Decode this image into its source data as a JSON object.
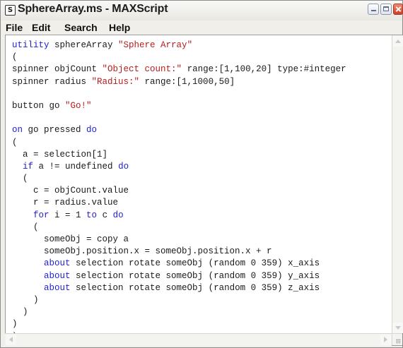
{
  "window": {
    "title": "SphereArray.ms - MAXScript",
    "app_icon_glyph": "S"
  },
  "menu": {
    "file": "File",
    "edit": "Edit",
    "search": "Search",
    "help": "Help"
  },
  "code": {
    "colors": {
      "keyword": "#1f1fd1",
      "string": "#b51c1c",
      "text": "#1a1a1a"
    },
    "lines": [
      [
        {
          "t": "utility",
          "c": "kw"
        },
        {
          "t": " sphereArray "
        },
        {
          "t": "\"Sphere Array\"",
          "c": "str"
        }
      ],
      [
        {
          "t": "("
        }
      ],
      [
        {
          "t": "spinner objCount "
        },
        {
          "t": "\"Object count:\"",
          "c": "str"
        },
        {
          "t": " range:[1,100,20] type:#integer"
        }
      ],
      [
        {
          "t": "spinner radius "
        },
        {
          "t": "\"Radius:\"",
          "c": "str"
        },
        {
          "t": " range:[1,1000,50]"
        }
      ],
      [
        {
          "t": ""
        }
      ],
      [
        {
          "t": "button go "
        },
        {
          "t": "\"Go!\"",
          "c": "str"
        }
      ],
      [
        {
          "t": ""
        }
      ],
      [
        {
          "t": "on",
          "c": "kw"
        },
        {
          "t": " go pressed "
        },
        {
          "t": "do",
          "c": "kw"
        }
      ],
      [
        {
          "t": "("
        }
      ],
      [
        {
          "t": "  a = selection[1]"
        }
      ],
      [
        {
          "t": "  "
        },
        {
          "t": "if",
          "c": "kw"
        },
        {
          "t": " a != undefined "
        },
        {
          "t": "do",
          "c": "kw"
        }
      ],
      [
        {
          "t": "  ("
        }
      ],
      [
        {
          "t": "    c = objCount.value"
        }
      ],
      [
        {
          "t": "    r = radius.value"
        }
      ],
      [
        {
          "t": "    "
        },
        {
          "t": "for",
          "c": "kw"
        },
        {
          "t": " i = 1 "
        },
        {
          "t": "to",
          "c": "kw"
        },
        {
          "t": " c "
        },
        {
          "t": "do",
          "c": "kw"
        }
      ],
      [
        {
          "t": "    ("
        }
      ],
      [
        {
          "t": "      someObj = copy a"
        }
      ],
      [
        {
          "t": "      someObj.position.x = someObj.position.x + r"
        }
      ],
      [
        {
          "t": "      "
        },
        {
          "t": "about",
          "c": "kw"
        },
        {
          "t": " selection rotate someObj (random 0 359) x_axis"
        }
      ],
      [
        {
          "t": "      "
        },
        {
          "t": "about",
          "c": "kw"
        },
        {
          "t": " selection rotate someObj (random 0 359) y_axis"
        }
      ],
      [
        {
          "t": "      "
        },
        {
          "t": "about",
          "c": "kw"
        },
        {
          "t": " selection rotate someObj (random 0 359) z_axis"
        }
      ],
      [
        {
          "t": "    )"
        }
      ],
      [
        {
          "t": "  )"
        }
      ],
      [
        {
          "t": ")"
        }
      ],
      [
        {
          "t": ")"
        }
      ]
    ]
  }
}
